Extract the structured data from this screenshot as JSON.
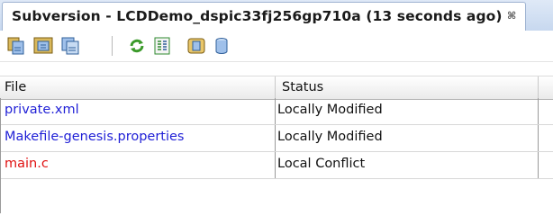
{
  "tab": {
    "title": "Subversion - LCDDemo_dspic33fj256gp710a (13 seconds ago)",
    "close_glyph": "⌘"
  },
  "toolbar": {
    "icons": [
      "show-all-changes-icon",
      "show-remote-changes-icon",
      "show-local-changes-icon",
      "refresh-status-icon",
      "diff-all-icon",
      "update-all-icon",
      "commit-all-icon"
    ]
  },
  "table": {
    "columns": [
      "File",
      "Status"
    ],
    "rows": [
      {
        "file": "private.xml",
        "status": "Locally Modified",
        "color": "#1f1fd6"
      },
      {
        "file": "Makefile-genesis.properties",
        "status": "Locally Modified",
        "color": "#1f1fd6"
      },
      {
        "file": "main.c",
        "status": "Local Conflict",
        "color": "#e01010"
      }
    ]
  }
}
